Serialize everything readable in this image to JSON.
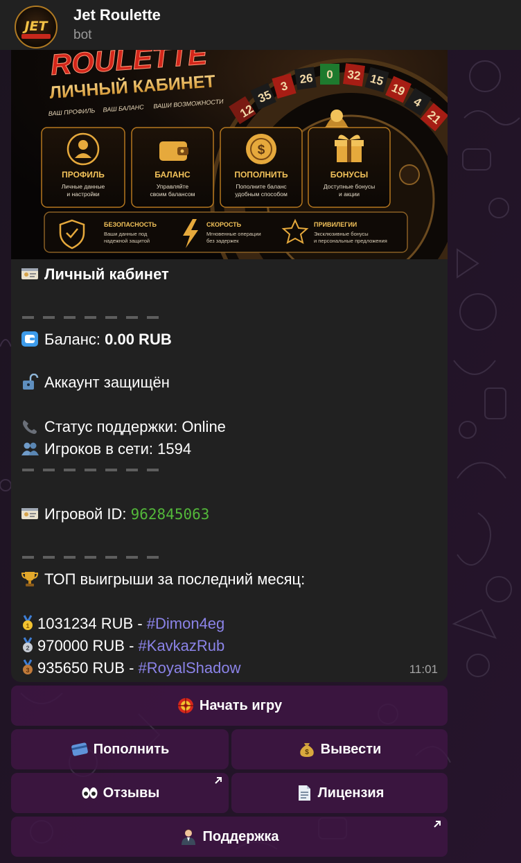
{
  "header": {
    "title": "Jet Roulette",
    "subtitle": "bot",
    "avatar_text": "JET",
    "avatar_subtext": "ROULETTE"
  },
  "banner": {
    "logo_text": "ROULETTE",
    "heading": "ЛИЧНЫЙ КАБИНЕТ",
    "tagline_1": "ВАШ ПРОФИЛЬ",
    "tagline_2": "ВАШ БАЛАНС",
    "tagline_3": "ВАШИ ВОЗМОЖНОСТИ",
    "wheel_numbers": [
      "12",
      "35",
      "3",
      "26",
      "0",
      "32",
      "15",
      "19",
      "4",
      "21"
    ],
    "cards": [
      {
        "title": "ПРОФИЛЬ",
        "line1": "Личные данные",
        "line2": "и настройки",
        "icon": "user-icon"
      },
      {
        "title": "БАЛАНС",
        "line1": "Управляйте",
        "line2": "своим балансом",
        "icon": "wallet-icon"
      },
      {
        "title": "ПОПОЛНИТЬ",
        "line1": "Пополните баланс",
        "line2": "удобным способом",
        "icon": "coin-icon"
      },
      {
        "title": "БОНУСЫ",
        "line1": "Доступные бонусы",
        "line2": "и акции",
        "icon": "gift-icon"
      }
    ],
    "features": [
      {
        "title": "БЕЗОПАСНОСТЬ",
        "line1": "Ваши данные под",
        "line2": "надежной защитой",
        "icon": "shield-icon"
      },
      {
        "title": "СКОРОСТЬ",
        "line1": "Мгновенные операции",
        "line2": "без задержек",
        "icon": "lightning-icon"
      },
      {
        "title": "ПРИВИЛЕГИИ",
        "line1": "Эксклюзивные бонусы",
        "line2": "и персональные предложения",
        "icon": "star-icon"
      }
    ]
  },
  "message": {
    "title": "Личный кабинет",
    "balance_label": "Баланс: ",
    "balance_value": "0.00 RUB",
    "account_status": "Аккаунт защищён",
    "support_status": "Статус поддержки: Online",
    "players_online": "Игроков в сети: 1594",
    "game_id_label": "Игровой ID: ",
    "game_id_value": "962845063",
    "top_wins_title": "ТОП выигрыши за последний месяц:",
    "top_wins": [
      {
        "amount": "1031234 RUB - ",
        "user": "#Dimon4eg",
        "medal": "gold-medal-icon"
      },
      {
        "amount": "970000 RUB - ",
        "user": "#KavkazRub",
        "medal": "silver-medal-icon"
      },
      {
        "amount": "935650 RUB - ",
        "user": "#RoyalShadow",
        "medal": "bronze-medal-icon"
      }
    ],
    "time": "11:01"
  },
  "keyboard": {
    "start_game": "Начать игру",
    "deposit": "Пополнить",
    "withdraw": "Вывести",
    "reviews": "Отзывы",
    "license": "Лицензия",
    "support": "Поддержка"
  },
  "colors": {
    "header_bg": "#212121",
    "bubble_bg": "#212121",
    "button_bg": "#3f1644",
    "game_id_color": "#53b83a",
    "hashtag_color": "#8b83e8",
    "banner_gold": "#e6a93c",
    "banner_red": "#d3261a"
  }
}
